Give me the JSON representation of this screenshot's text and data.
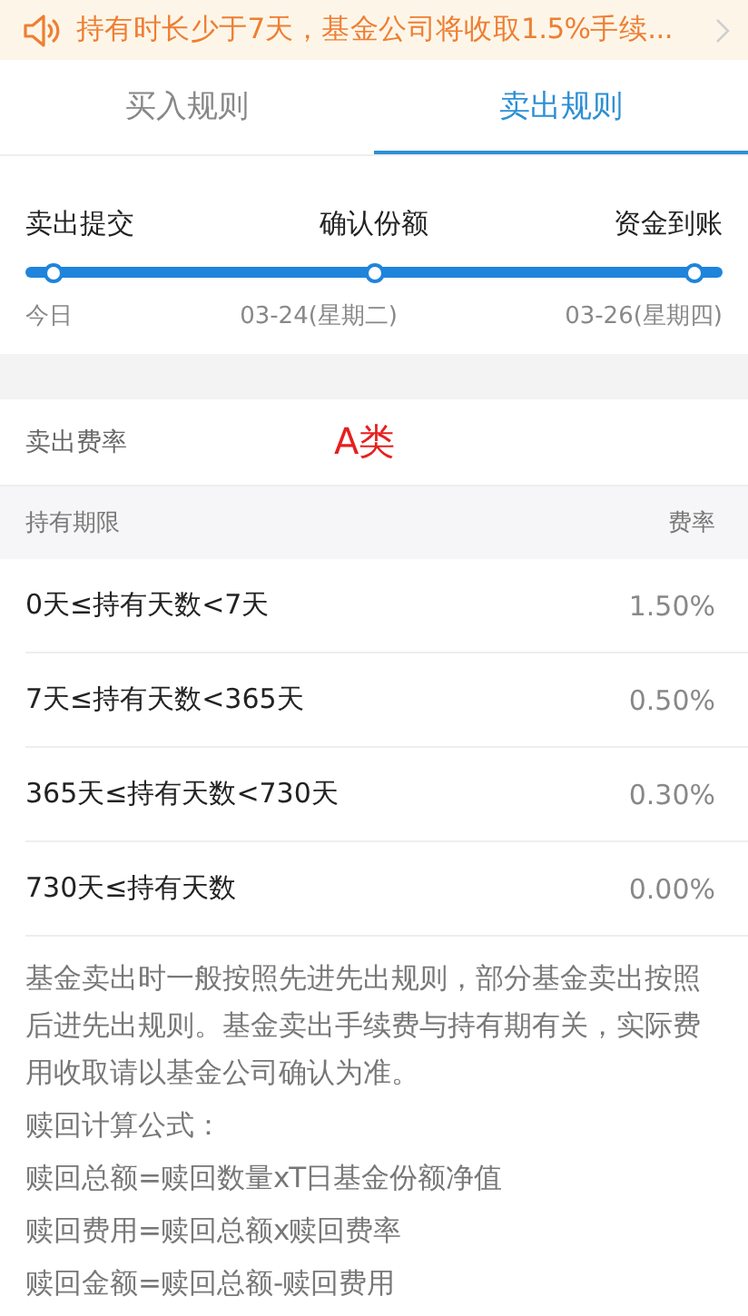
{
  "notice": {
    "text": "持有时长少于7天，基金公司将收取1.5%手续..."
  },
  "tabs": [
    {
      "label": "买入规则",
      "selected": false
    },
    {
      "label": "卖出规则",
      "selected": true
    }
  ],
  "timeline": {
    "steps": [
      {
        "title": "卖出提交",
        "date": "今日"
      },
      {
        "title": "确认份额",
        "date": "03-24(星期二)"
      },
      {
        "title": "资金到账",
        "date": "03-26(星期四)"
      }
    ]
  },
  "fee_section": {
    "title": "卖出费率",
    "annotation": "A类",
    "columns": [
      "持有期限",
      "费率"
    ],
    "rows": [
      {
        "period": "0天≤持有天数<7天",
        "rate": "1.50%"
      },
      {
        "period": "7天≤持有天数<365天",
        "rate": "0.50%"
      },
      {
        "period": "365天≤持有天数<730天",
        "rate": "0.30%"
      },
      {
        "period": "730天≤持有天数",
        "rate": "0.00%"
      }
    ]
  },
  "notes": [
    "基金卖出时一般按照先进先出规则，部分基金卖出按照后进先出规则。基金卖出手续费与持有期有关，实际费用收取请以基金公司确认为准。",
    "赎回计算公式：",
    "赎回总额=赎回数量xT日基金份额净值",
    "赎回费用=赎回总额x赎回费率",
    "赎回金额=赎回总额-赎回费用"
  ]
}
